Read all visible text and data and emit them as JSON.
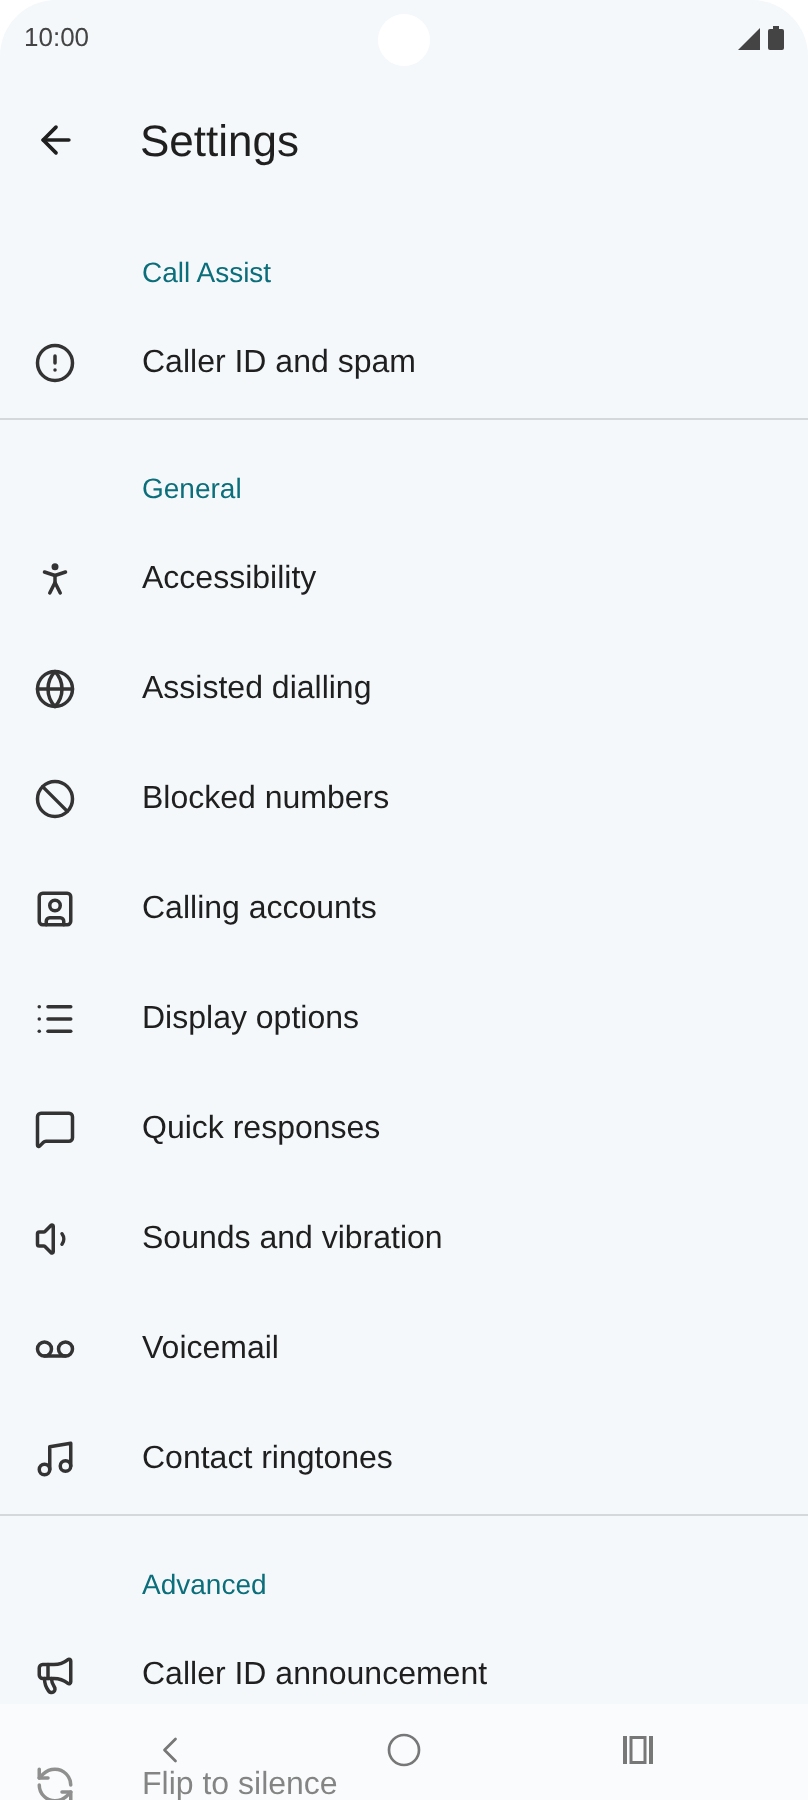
{
  "status_bar": {
    "time": "10:00"
  },
  "title": "Settings",
  "sections": [
    {
      "header": "Call Assist",
      "items": [
        {
          "label": "Caller ID and spam"
        }
      ]
    },
    {
      "header": "General",
      "items": [
        {
          "label": "Accessibility"
        },
        {
          "label": "Assisted dialling"
        },
        {
          "label": "Blocked numbers"
        },
        {
          "label": "Calling accounts"
        },
        {
          "label": "Display options"
        },
        {
          "label": "Quick responses"
        },
        {
          "label": "Sounds and vibration"
        },
        {
          "label": "Voicemail"
        },
        {
          "label": "Contact ringtones"
        }
      ]
    },
    {
      "header": "Advanced",
      "items": [
        {
          "label": "Caller ID announcement"
        },
        {
          "label": "Flip to silence"
        }
      ]
    }
  ]
}
